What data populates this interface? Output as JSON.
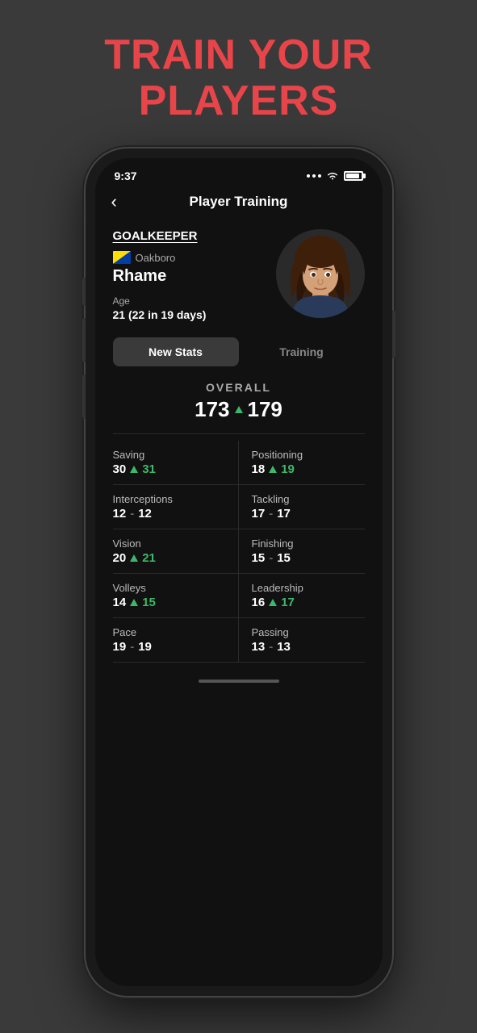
{
  "headline": {
    "line1": "TRAIN YOUR",
    "line2": "PLAYERS"
  },
  "status_bar": {
    "time": "9:37",
    "dots": 3
  },
  "nav": {
    "title": "Player Training",
    "back_label": "‹"
  },
  "player": {
    "position": "GOALKEEPER",
    "team": "Oakboro",
    "name": "Rhame",
    "age_label": "Age",
    "age_value": "21 (22 in 19 days)"
  },
  "tabs": {
    "active": "New Stats",
    "inactive": "Training"
  },
  "overall": {
    "label": "OVERALL",
    "old_value": "173",
    "new_value": "179"
  },
  "stats": [
    {
      "name": "Saving",
      "old": "30",
      "new": "31",
      "changed": true
    },
    {
      "name": "Positioning",
      "old": "18",
      "new": "19",
      "changed": true
    },
    {
      "name": "Interceptions",
      "old": "12",
      "new": "12",
      "changed": false
    },
    {
      "name": "Tackling",
      "old": "17",
      "new": "17",
      "changed": false
    },
    {
      "name": "Vision",
      "old": "20",
      "new": "21",
      "changed": true
    },
    {
      "name": "Finishing",
      "old": "15",
      "new": "15",
      "changed": false
    },
    {
      "name": "Volleys",
      "old": "14",
      "new": "15",
      "changed": true
    },
    {
      "name": "Leadership",
      "old": "16",
      "new": "17",
      "changed": true
    },
    {
      "name": "Pace",
      "old": "19",
      "new": "19",
      "changed": false
    },
    {
      "name": "Passing",
      "old": "13",
      "new": "13",
      "changed": false
    }
  ]
}
